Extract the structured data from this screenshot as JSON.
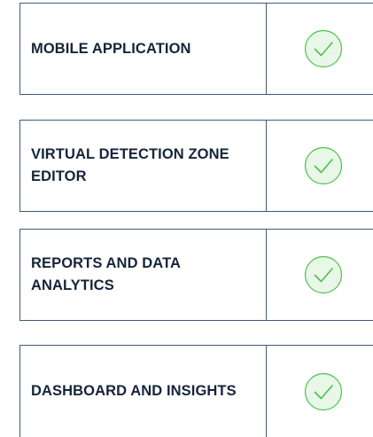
{
  "features": [
    {
      "label": "MOBILE APPLICATION",
      "check_icon": "checkmark-circle-icon"
    },
    {
      "label": "VIRTUAL DETECTION ZONE EDITOR",
      "check_icon": "checkmark-circle-icon"
    },
    {
      "label": "REPORTS AND DATA ANALYTICS",
      "check_icon": "checkmark-circle-icon"
    },
    {
      "label": "DASHBOARD AND INSIGHTS",
      "check_icon": "checkmark-circle-icon"
    }
  ],
  "colors": {
    "border": "#3f5a7a",
    "text": "#16243a",
    "check_fill": "#e8f7e8",
    "check_stroke": "#4cc24c"
  }
}
